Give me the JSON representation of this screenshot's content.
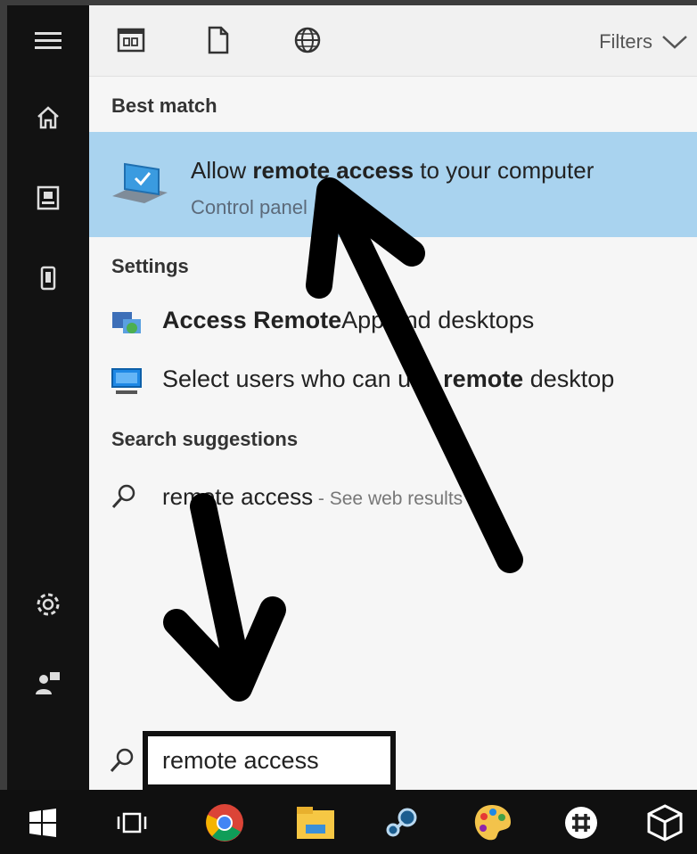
{
  "filter_bar": {
    "filters_label": "Filters"
  },
  "best_match": {
    "section_title": "Best match",
    "title_before": "Allow ",
    "title_bold": "remote access",
    "title_after": " to your computer",
    "subtitle": "Control panel"
  },
  "settings": {
    "section_title": "Settings",
    "items": [
      {
        "bold": "Access Remote",
        "rest": "App and desktops"
      },
      {
        "pre": "Select users who can use ",
        "bold": "remote",
        "rest": " desktop"
      }
    ]
  },
  "suggestions": {
    "section_title": "Search suggestions",
    "items": [
      {
        "query": "remote access",
        "hint": " - See web results"
      }
    ]
  },
  "search": {
    "value": "remote access"
  },
  "colors": {
    "highlight": "#a9d3ef",
    "rail_bg": "#121212",
    "taskbar_bg": "#101010"
  }
}
